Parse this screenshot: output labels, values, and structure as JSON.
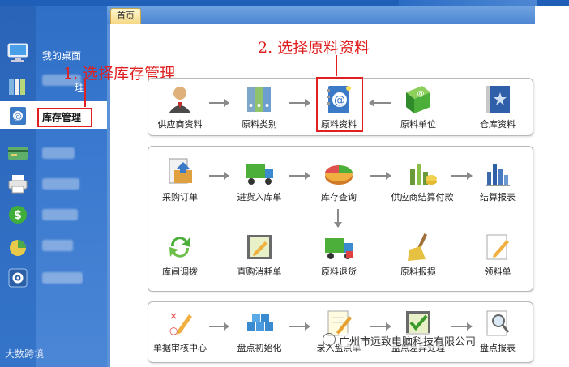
{
  "tabs": [
    {
      "label": "首页"
    }
  ],
  "sidebar": {
    "items": [
      {
        "label": "我的桌面",
        "icon": "monitor-icon"
      },
      {
        "label": "理",
        "icon": "books-icon"
      },
      {
        "label": "库存管理",
        "icon": "address-book-icon",
        "active": true
      },
      {
        "label": "",
        "icon": "card-icon"
      },
      {
        "label": "",
        "icon": "printer-icon"
      },
      {
        "label": "",
        "icon": "dollar-icon"
      },
      {
        "label": "",
        "icon": "chart-icon"
      },
      {
        "label": "",
        "icon": "gear-icon"
      }
    ],
    "brand": "大数跨境"
  },
  "annotations": {
    "step1": "1. 选择库存管理",
    "step2": "2. 选择原料资料"
  },
  "panel1": {
    "items": [
      {
        "label": "供应商资料",
        "icon": "supplier-person-icon"
      },
      {
        "label": "原料类别",
        "icon": "binders-icon"
      },
      {
        "label": "原料资料",
        "icon": "address-book-icon"
      },
      {
        "label": "原料单位",
        "icon": "green-book-icon"
      },
      {
        "label": "仓库资料",
        "icon": "blue-star-book-icon"
      }
    ]
  },
  "panel2": {
    "row1": [
      {
        "label": "采购订单",
        "icon": "purchase-order-icon"
      },
      {
        "label": "进货入库单",
        "icon": "truck-icon"
      },
      {
        "label": "库存查询",
        "icon": "pie-chart-icon"
      },
      {
        "label": "供应商结算付款",
        "icon": "coins-chart-icon"
      },
      {
        "label": "结算报表",
        "icon": "bar-report-icon"
      }
    ],
    "row2": [
      {
        "label": "库间调拨",
        "icon": "refresh-icon"
      },
      {
        "label": "直购消耗单",
        "icon": "edit-board-icon"
      },
      {
        "label": "原料退货",
        "icon": "return-truck-icon"
      },
      {
        "label": "原料报损",
        "icon": "broom-icon"
      },
      {
        "label": "领料单",
        "icon": "note-pencil-icon"
      }
    ]
  },
  "panel3": {
    "items": [
      {
        "label": "单据审核中心",
        "icon": "audit-icon"
      },
      {
        "label": "盘点初始化",
        "icon": "cubes-icon"
      },
      {
        "label": "录入盘点单",
        "icon": "notepad-pencil-icon"
      },
      {
        "label": "盘点差异处理",
        "icon": "check-board-icon"
      },
      {
        "label": "盘点报表",
        "icon": "magnifier-report-icon"
      }
    ]
  },
  "watermark": "广州市远致电脑科技有限公司",
  "colors": {
    "accent": "#2f6fc6",
    "annotation": "#e02020",
    "tab": "#f5d884"
  }
}
